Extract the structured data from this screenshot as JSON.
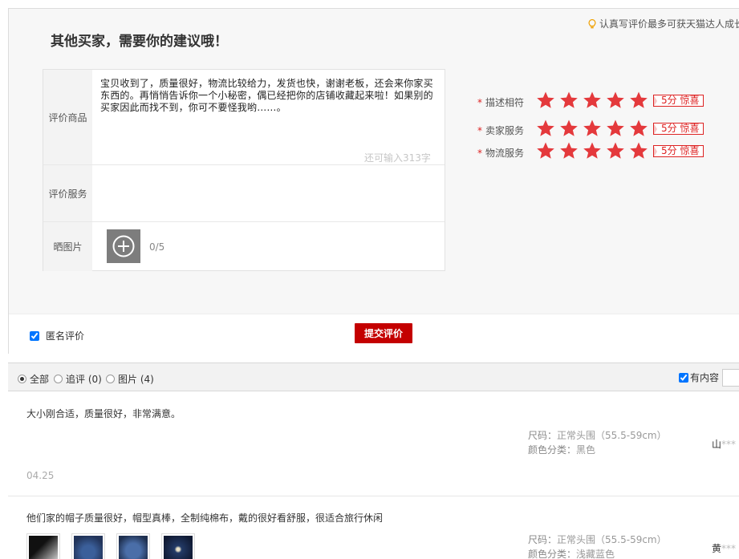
{
  "panel": {
    "title": "其他买家，需要你的建议哦！",
    "tip": "认真写评价最多可获天猫达人成长值"
  },
  "form": {
    "product_label": "评价商品",
    "comment_text": "宝贝收到了，质量很好，物流比较给力，发货也快，谢谢老板，还会来你家买东西的。再悄悄告诉你一个小秘密，偶已经把你的店铺收藏起来啦！如果别的买家因此而找不到，你可不要怪我哟……。",
    "counter": "还可输入313字",
    "service_label": "评价服务",
    "photo_label": "晒图片",
    "photo_count": "0/5"
  },
  "ratings": [
    {
      "label": "描述相符",
      "stars": 5,
      "badge": "5分 惊喜"
    },
    {
      "label": "卖家服务",
      "stars": 5,
      "badge": "5分 惊喜"
    },
    {
      "label": "物流服务",
      "stars": 5,
      "badge": "5分 惊喜"
    }
  ],
  "footer": {
    "anonymous_label": "匿名评价",
    "submit_label": "提交评价"
  },
  "filter": {
    "all": "全部",
    "followup": "追评",
    "followup_count": "(0)",
    "pics": "图片",
    "pics_count": "(4)",
    "has_content": "有内容"
  },
  "reviews": [
    {
      "text": "大小刚合适，质量很好，非常满意。",
      "size_label": "尺码：",
      "size": "正常头围（55.5-59cm）",
      "color_label": "颜色分类：",
      "color": "黑色",
      "date": "04.25",
      "user": "山",
      "user_mask": "***"
    },
    {
      "text": "他们家的帽子质量很好，帽型真棒，全制纯棉布，戴的很好看舒服，很适合旅行休闲",
      "size_label": "尺码：",
      "size": "正常头围（55.5-59cm）",
      "color_label": "颜色分类：",
      "color": "浅藏蓝色",
      "user": "黄",
      "user_mask": "***"
    }
  ],
  "colors": {
    "accent": "#c40000",
    "star": "#e4393c",
    "panel_bg": "#f7f7f7"
  }
}
